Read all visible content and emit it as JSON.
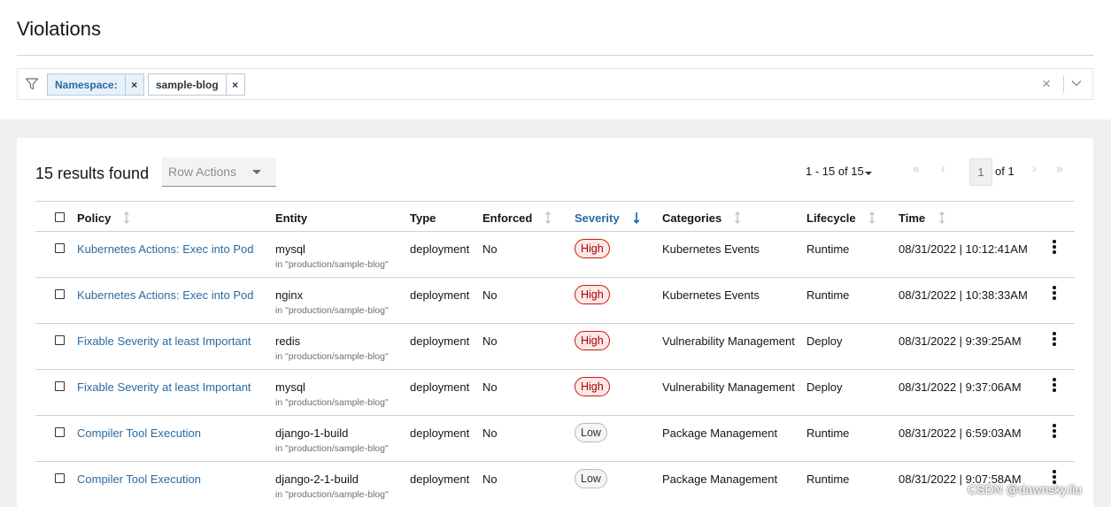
{
  "page": {
    "title": "Violations"
  },
  "filter": {
    "chips": [
      {
        "label": "Namespace:",
        "remove": "×"
      },
      {
        "label": "sample-blog",
        "remove": "×"
      }
    ],
    "clear_all": "×"
  },
  "toolbar": {
    "results": "15 results found",
    "row_actions": "Row Actions",
    "pagination": {
      "range": "1 - 15 of 15",
      "page": "1",
      "of": "of 1"
    }
  },
  "columns": {
    "policy": "Policy",
    "entity": "Entity",
    "type": "Type",
    "enforced": "Enforced",
    "severity": "Severity",
    "categories": "Categories",
    "lifecycle": "Lifecycle",
    "time": "Time"
  },
  "rows": [
    {
      "policy": "Kubernetes Actions: Exec into Pod",
      "entity": "mysql",
      "entity_sub": "in \"production/sample-blog\"",
      "type": "deployment",
      "enforced": "No",
      "severity": "High",
      "category": "Kubernetes Events",
      "lifecycle": "Runtime",
      "time": "08/31/2022 | 10:12:41AM"
    },
    {
      "policy": "Kubernetes Actions: Exec into Pod",
      "entity": "nginx",
      "entity_sub": "in \"production/sample-blog\"",
      "type": "deployment",
      "enforced": "No",
      "severity": "High",
      "category": "Kubernetes Events",
      "lifecycle": "Runtime",
      "time": "08/31/2022 | 10:38:33AM"
    },
    {
      "policy": "Fixable Severity at least Important",
      "entity": "redis",
      "entity_sub": "in \"production/sample-blog\"",
      "type": "deployment",
      "enforced": "No",
      "severity": "High",
      "category": "Vulnerability Management",
      "lifecycle": "Deploy",
      "time": "08/31/2022 | 9:39:25AM"
    },
    {
      "policy": "Fixable Severity at least Important",
      "entity": "mysql",
      "entity_sub": "in \"production/sample-blog\"",
      "type": "deployment",
      "enforced": "No",
      "severity": "High",
      "category": "Vulnerability Management",
      "lifecycle": "Deploy",
      "time": "08/31/2022 | 9:37:06AM"
    },
    {
      "policy": "Compiler Tool Execution",
      "entity": "django-1-build",
      "entity_sub": "in \"production/sample-blog\"",
      "type": "deployment",
      "enforced": "No",
      "severity": "Low",
      "category": "Package Management",
      "lifecycle": "Runtime",
      "time": "08/31/2022 | 6:59:03AM"
    },
    {
      "policy": "Compiler Tool Execution",
      "entity": "django-2-1-build",
      "entity_sub": "in \"production/sample-blog\"",
      "type": "deployment",
      "enforced": "No",
      "severity": "Low",
      "category": "Package Management",
      "lifecycle": "Runtime",
      "time": "08/31/2022 | 9:07:58AM"
    }
  ],
  "watermark": "CSDN @dawnsky.liu",
  "colors": {
    "link": "#2b6aa0",
    "high": "#c9190b",
    "sort_active": "#0066cc"
  }
}
